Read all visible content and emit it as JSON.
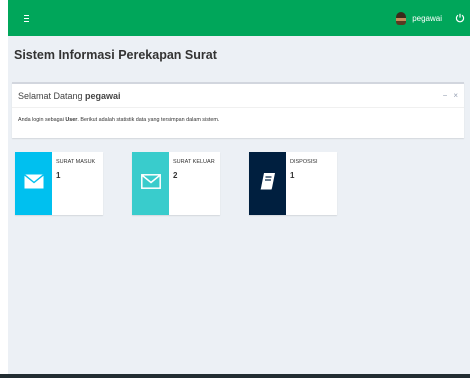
{
  "header": {
    "user_name": "pegawai"
  },
  "page": {
    "title": "Sistem Informasi Perekapan Surat"
  },
  "welcome_box": {
    "title_prefix": "Selamat Datang ",
    "title_user": "pegawai",
    "collapse_label": "−",
    "close_label": "×",
    "body_prefix": "Anda login sebagai ",
    "body_role": "User",
    "body_suffix": ". Berikut adalah statistik data yang tersimpan dalam sistem."
  },
  "stats": [
    {
      "label": "SURAT MASUK",
      "value": "1",
      "color": "#00c0ef",
      "icon": "envelope-icon"
    },
    {
      "label": "SURAT KELUAR",
      "value": "2",
      "color": "#39cccc",
      "icon": "envelope-outline-icon"
    },
    {
      "label": "DISPOSISI",
      "value": "1",
      "color": "#001f3f",
      "icon": "book-icon"
    }
  ],
  "colors": {
    "topbar": "#00a65a",
    "background": "#ecf0f5"
  }
}
